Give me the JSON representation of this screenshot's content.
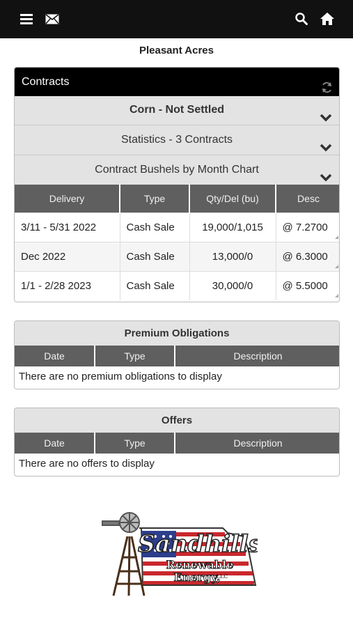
{
  "header": {
    "icons": [
      "menu-icon",
      "mail-icon",
      "search-icon",
      "home-icon"
    ]
  },
  "farm_name": "Pleasant Acres",
  "contracts": {
    "title": "Contracts",
    "section_title": "Corn - Not Settled",
    "statistics_label": "Statistics - 3 Contracts",
    "chart_label": "Contract Bushels by Month Chart",
    "columns": [
      "Delivery",
      "Type",
      "Qty/Del (bu)",
      "Desc"
    ],
    "rows": [
      {
        "delivery": "3/11 - 5/31 2022",
        "type": "Cash Sale",
        "qty": "19,000/1,015",
        "desc": "@ 7.2700"
      },
      {
        "delivery": "Dec 2022",
        "type": "Cash Sale",
        "qty": "13,000/0",
        "desc": "@ 6.3000"
      },
      {
        "delivery": "1/1 - 2/28 2023",
        "type": "Cash Sale",
        "qty": "30,000/0",
        "desc": "@ 5.5000"
      }
    ]
  },
  "premium": {
    "title": "Premium Obligations",
    "columns": [
      "Date",
      "Type",
      "Description"
    ],
    "empty_message": "There are no premium obligations to display"
  },
  "offers": {
    "title": "Offers",
    "columns": [
      "Date",
      "Type",
      "Description"
    ],
    "empty_message": "There are no offers to display"
  },
  "logo": {
    "line1": "Sandhills",
    "line2": "Renewable",
    "line3": "Energy,",
    "suffix": "LLC"
  },
  "colors": {
    "topbar": "#111111",
    "panel_header": "#000000",
    "table_header": "#5f5f5f",
    "accordion": "#e3e3e3"
  }
}
